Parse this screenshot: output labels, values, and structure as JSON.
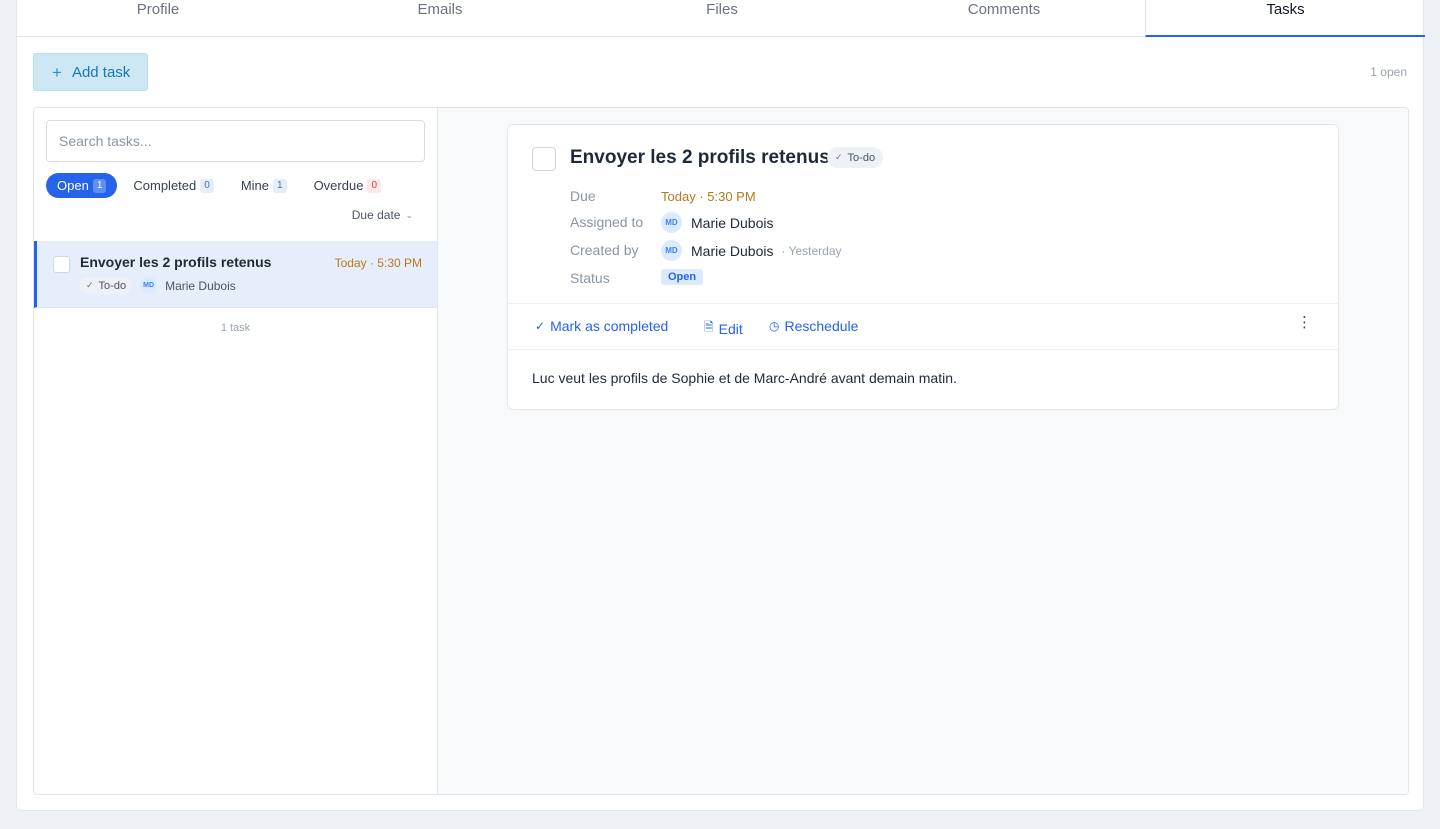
{
  "tabs": [
    "Profile",
    "Emails",
    "Files",
    "Comments",
    "Tasks"
  ],
  "toolbar": {
    "add_task_label": "Add task",
    "open_count": "1 open"
  },
  "search": {
    "placeholder": "Search tasks..."
  },
  "filters": [
    {
      "label": "Open",
      "count": "1"
    },
    {
      "label": "Completed",
      "count": "0"
    },
    {
      "label": "Mine",
      "count": "1"
    },
    {
      "label": "Overdue",
      "count": "0"
    }
  ],
  "sort": {
    "label": "Due date"
  },
  "task_list": {
    "items": [
      {
        "title": "Envoyer les 2 profils retenus",
        "due": "Today · 5:30 PM",
        "type": "To-do",
        "assignee_initials": "MD",
        "assignee": "Marie Dubois"
      }
    ],
    "count_label": "1 task"
  },
  "detail": {
    "title": "Envoyer les 2 profils retenus",
    "type": "To-do",
    "due_label": "Due",
    "due_value": "Today · 5:30 PM",
    "assigned_label": "Assigned to",
    "assigned_initials": "MD",
    "assigned_name": "Marie Dubois",
    "created_label": "Created by",
    "created_initials": "MD",
    "created_name": "Marie Dubois",
    "created_ago": "· Yesterday",
    "status_label": "Status",
    "status_value": "Open",
    "actions": {
      "complete": "Mark as completed",
      "edit": "Edit",
      "reschedule": "Reschedule"
    },
    "description": "Luc veut les profils de Sophie et de Marc-André avant demain matin."
  },
  "icons": {
    "add": "plus-icon",
    "check": "check-icon",
    "doc": "document-icon",
    "clock": "clock-icon",
    "more": "more-vertical-icon",
    "chevron": "chevron-down-icon"
  },
  "colors": {
    "accent": "#2563eb",
    "due": "#b7791f",
    "add_button_bg": "#cde7f4"
  }
}
